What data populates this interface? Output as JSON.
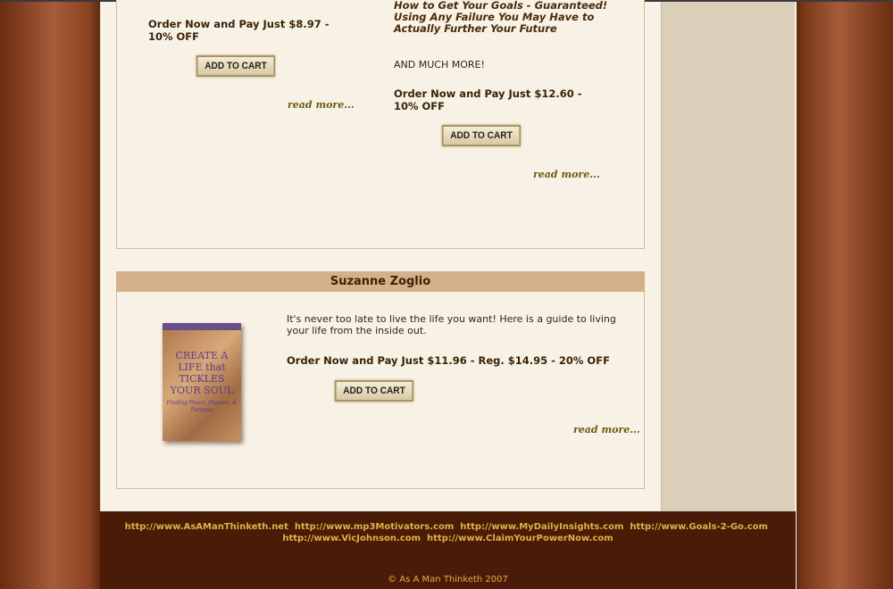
{
  "product1": {
    "price": "Order Now and Pay Just $8.97 - 10% OFF",
    "add_to_cart": "ADD TO CART",
    "read_more": "read more..."
  },
  "product2": {
    "bullets": [
      "How to Get Your Goals - Guaranteed!",
      "Using Any Failure You May Have to Actually Further Your Future"
    ],
    "more": "AND MUCH MORE!",
    "price": "Order Now and Pay Just $12.60 - 10% OFF",
    "add_to_cart": "ADD TO CART",
    "read_more": "read more..."
  },
  "product3": {
    "author": "Suzanne Zoglio",
    "cover_title": "CREATE A LIFE that TICKLES YOUR SOUL",
    "cover_subtitle": "Finding Peace, Passion, & Purpose",
    "description": "It's never too late to live the life you want! Here is a guide to living your life from the inside out.",
    "price": "Order Now and Pay Just $11.96 - Reg. $14.95 - 20% OFF",
    "add_to_cart": "ADD TO CART",
    "read_more": "read more..."
  },
  "footer": {
    "links": [
      "http://www.AsAManThinketh.net",
      "http://www.mp3Motivators.com",
      "http://www.MyDailyInsights.com",
      "http://www.Goals-2-Go.com",
      "http://www.VicJohnson.com",
      "http://www.ClaimYourPowerNow.com"
    ],
    "copyright": "© As A Man Thinketh 2007"
  }
}
